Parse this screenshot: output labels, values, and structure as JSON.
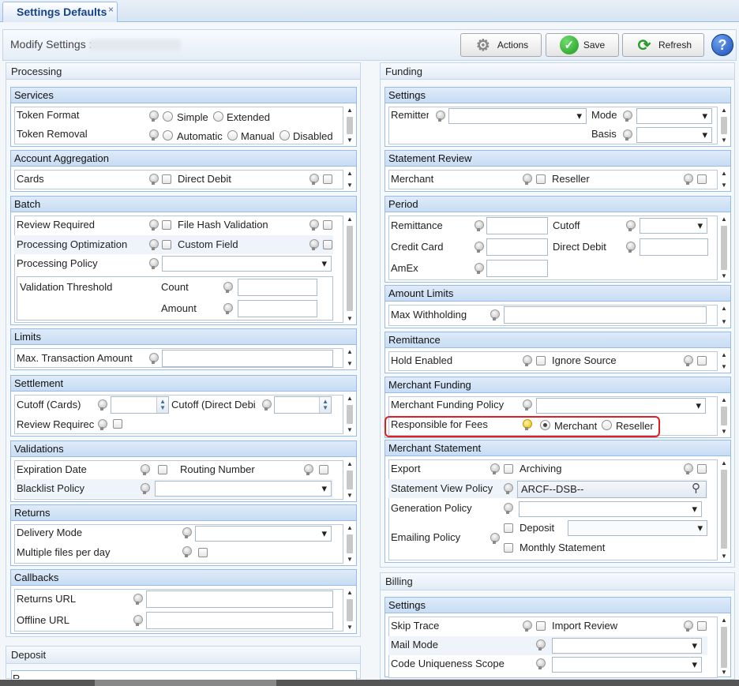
{
  "tab": {
    "title": "Settings Defaults",
    "close": "×"
  },
  "header": {
    "modify_label": "Modify Settings :"
  },
  "toolbar": {
    "actions": "Actions",
    "save": "Save",
    "refresh": "Refresh",
    "help": "?"
  },
  "processing": {
    "title": "Processing",
    "services": {
      "title": "Services",
      "token_format": "Token Format",
      "simple": "Simple",
      "extended": "Extended",
      "token_removal": "Token Removal",
      "automatic": "Automatic",
      "manual": "Manual",
      "disabled": "Disabled"
    },
    "account_aggregation": {
      "title": "Account Aggregation",
      "cards": "Cards",
      "direct_debit": "Direct Debit"
    },
    "batch": {
      "title": "Batch",
      "review_required": "Review Required",
      "file_hash_validation": "File Hash Validation",
      "processing_optimization": "Processing Optimization",
      "custom_field": "Custom Field",
      "processing_policy": "Processing Policy",
      "validation_threshold": "Validation Threshold",
      "count": "Count",
      "amount": "Amount"
    },
    "limits": {
      "title": "Limits",
      "max_transaction_amount": "Max. Transaction Amount"
    },
    "settlement": {
      "title": "Settlement",
      "cutoff_cards": "Cutoff (Cards)",
      "cutoff_direct_debit": "Cutoff (Direct Debi",
      "review_required": "Review Requirec"
    },
    "validations": {
      "title": "Validations",
      "expiration_date": "Expiration Date",
      "routing_number": "Routing Number",
      "blacklist_policy": "Blacklist Policy"
    },
    "returns": {
      "title": "Returns",
      "delivery_mode": "Delivery Mode",
      "multiple_files": "Multiple files per day"
    },
    "callbacks": {
      "title": "Callbacks",
      "returns_url": "Returns URL",
      "offline_url": "Offline URL"
    }
  },
  "deposit": {
    "title": "Deposit",
    "row_label": "R"
  },
  "funding": {
    "title": "Funding",
    "settings": {
      "title": "Settings",
      "remitter": "Remitter",
      "mode": "Mode",
      "basis": "Basis"
    },
    "statement_review": {
      "title": "Statement Review",
      "merchant": "Merchant",
      "reseller": "Reseller"
    },
    "period": {
      "title": "Period",
      "remittance": "Remittance",
      "cutoff": "Cutoff",
      "credit_card": "Credit Card",
      "direct_debit": "Direct Debit",
      "amex": "AmEx"
    },
    "amount_limits": {
      "title": "Amount Limits",
      "max_withholding": "Max Withholding"
    },
    "remittance": {
      "title": "Remittance",
      "hold_enabled": "Hold Enabled",
      "ignore_source": "Ignore Source"
    },
    "merchant_funding": {
      "title": "Merchant Funding",
      "policy": "Merchant Funding Policy",
      "responsible_for_fees": "Responsible for Fees",
      "merchant": "Merchant",
      "reseller": "Reseller"
    },
    "merchant_statement": {
      "title": "Merchant Statement",
      "export": "Export",
      "archiving": "Archiving",
      "statement_view_policy": "Statement View Policy",
      "statement_view_value": "ARCF--DSB--",
      "generation_policy": "Generation Policy",
      "emailing_policy": "Emailing Policy",
      "deposit": "Deposit",
      "monthly_statement": "Monthly Statement"
    }
  },
  "billing": {
    "title": "Billing",
    "settings": {
      "title": "Settings",
      "skip_trace": "Skip Trace",
      "import_review": "Import Review",
      "mail_mode": "Mail Mode",
      "code_uniqueness_scope": "Code Uniqueness Scope"
    }
  }
}
